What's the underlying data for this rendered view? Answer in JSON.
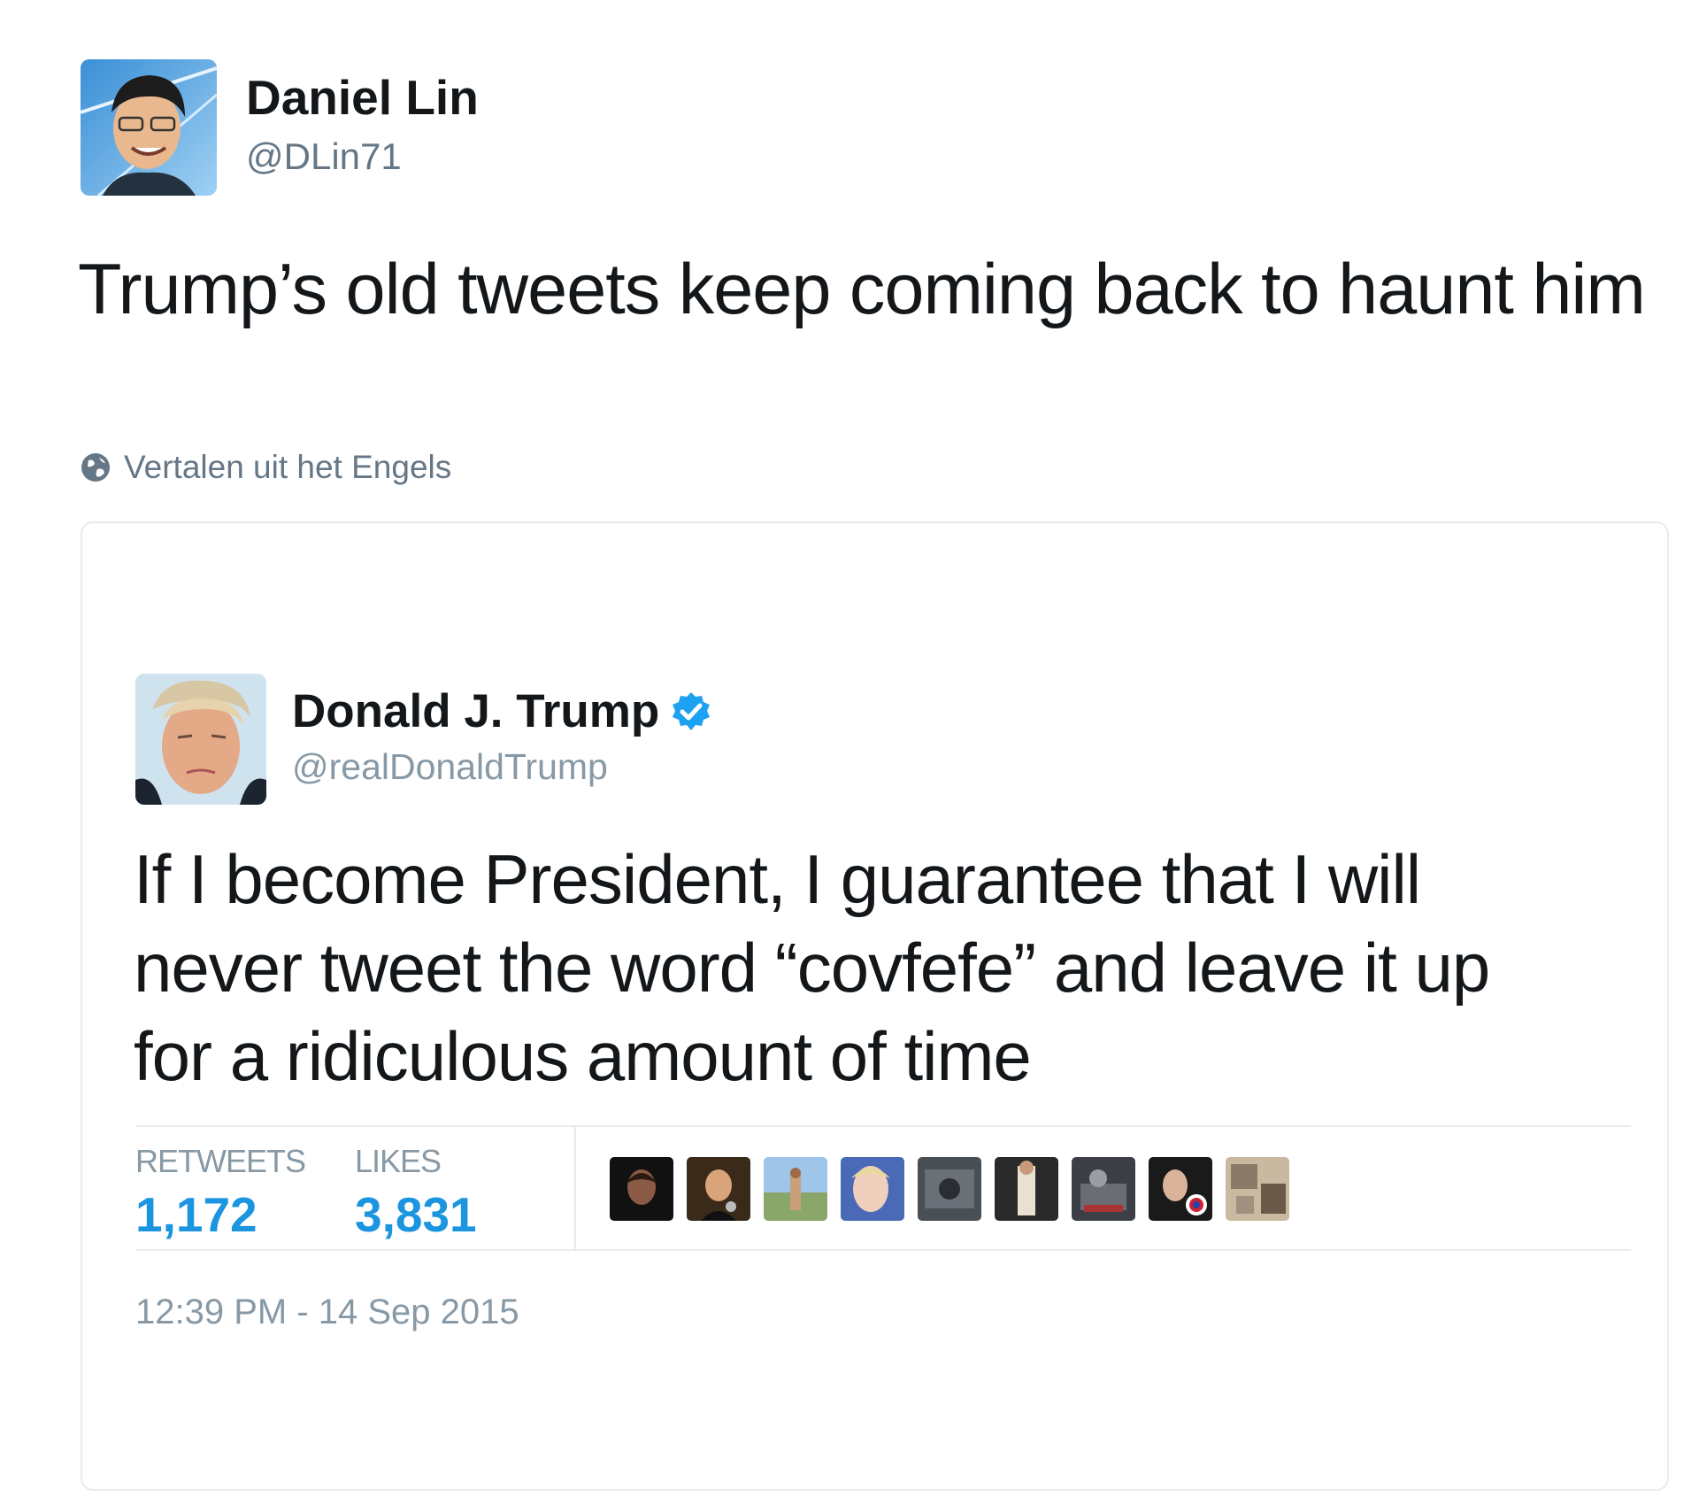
{
  "outer_tweet": {
    "name": "Daniel Lin",
    "handle": "@DLin71",
    "text": "Trump’s old tweets keep coming back to haunt him",
    "translate_label": "Vertalen uit het Engels",
    "translate_icon": "globe-icon"
  },
  "quoted_tweet": {
    "name": "Donald J. Trump",
    "verified_icon": "verified-badge-icon",
    "handle": "@realDonaldTrump",
    "text": "If I become President, I guarantee that I will never tweet the word “covfefe” and leave it up for a ridiculous amount of time",
    "stats": {
      "retweets_label": "RETWEETS",
      "retweets_value": "1,172",
      "likes_label": "LIKES",
      "likes_value": "3,831"
    },
    "timestamp": "12:39 PM - 14 Sep 2015"
  },
  "colors": {
    "link_blue": "#1b95e0",
    "text_dark": "#14171a",
    "text_gray": "#657786",
    "border": "#e6ecf0"
  }
}
